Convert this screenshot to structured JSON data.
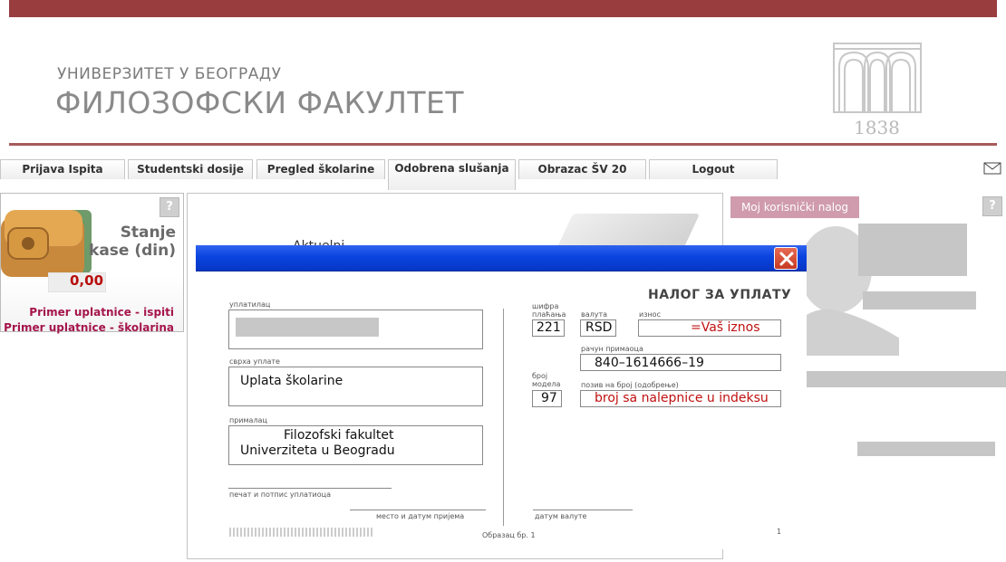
{
  "header": {
    "university": "УНИВЕРЗИТЕТ У БЕОГРАДУ",
    "faculty": "ФИЛОЗОФСКИ ФАКУЛТЕТ",
    "logo_year": "1838"
  },
  "nav": {
    "tabs": [
      {
        "label": "Prijava Ispita"
      },
      {
        "label": "Studentski dosije"
      },
      {
        "label": "Pregled školarine"
      },
      {
        "label": "Odobrena slušanja"
      },
      {
        "label": "Obrazac ŠV 20"
      },
      {
        "label": "Logout"
      }
    ]
  },
  "wallet": {
    "help": "?",
    "title_line1": "Stanje",
    "title_line2": "kase (din)",
    "amount": "0,00",
    "link_exams": "Primer uplatnice - ispiti",
    "link_tuition": "Primer uplatnice - školarina"
  },
  "center": {
    "partial_text": "Aktuelni ..."
  },
  "account": {
    "button": "Moj korisnički nalog",
    "help": "?"
  },
  "slip": {
    "title": "НАЛОГ ЗА УПЛАТУ",
    "payer_label": "уплатилац",
    "purpose_label": "сврха уплате",
    "purpose_value": "Uplata školarine",
    "recipient_label": "прималац",
    "recipient_line1": "Filozofski fakultet",
    "recipient_line2": "Univerziteta u Beogradu",
    "code_label": "шифра плаћања",
    "code_value": "221",
    "currency_label": "валута",
    "currency_value": "RSD",
    "amount_label": "износ",
    "amount_value": "=Vaš iznos",
    "account_label": "рачун примаоца",
    "account_value": "840–1614666–19",
    "model_label": "број модела",
    "model_value": "97",
    "reference_label": "позив на број (одобрење)",
    "reference_value": "broj sa nalepnice u indeksu",
    "signature_label": "печат и потпис уплатиоца",
    "place_date_label": "место и датум пријема",
    "value_date_label": "датум валуте",
    "form_number": "Образац бр. 1",
    "page_number": "1"
  }
}
